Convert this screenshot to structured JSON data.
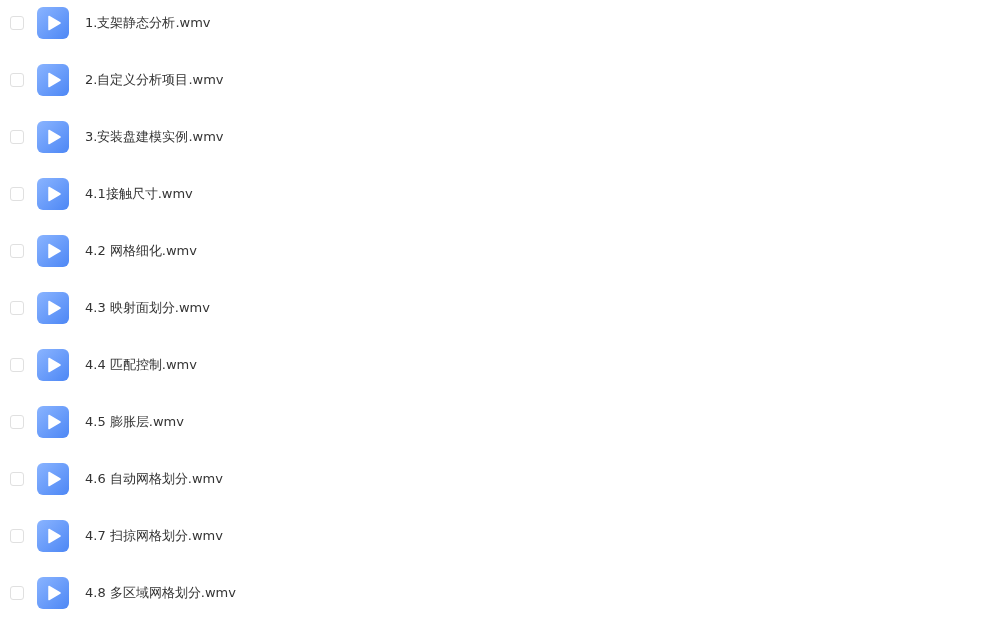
{
  "files": [
    {
      "name": "1.支架静态分析.wmv",
      "checked": false
    },
    {
      "name": "2.自定义分析项目.wmv",
      "checked": false
    },
    {
      "name": "3.安装盘建模实例.wmv",
      "checked": false
    },
    {
      "name": "4.1接触尺寸.wmv",
      "checked": false
    },
    {
      "name": "4.2 网格细化.wmv",
      "checked": false
    },
    {
      "name": "4.3 映射面划分.wmv",
      "checked": false
    },
    {
      "name": "4.4 匹配控制.wmv",
      "checked": false
    },
    {
      "name": "4.5 膨胀层.wmv",
      "checked": false
    },
    {
      "name": "4.6 自动网格划分.wmv",
      "checked": false
    },
    {
      "name": "4.7 扫掠网格划分.wmv",
      "checked": false
    },
    {
      "name": "4.8 多区域网格划分.wmv",
      "checked": false
    }
  ]
}
